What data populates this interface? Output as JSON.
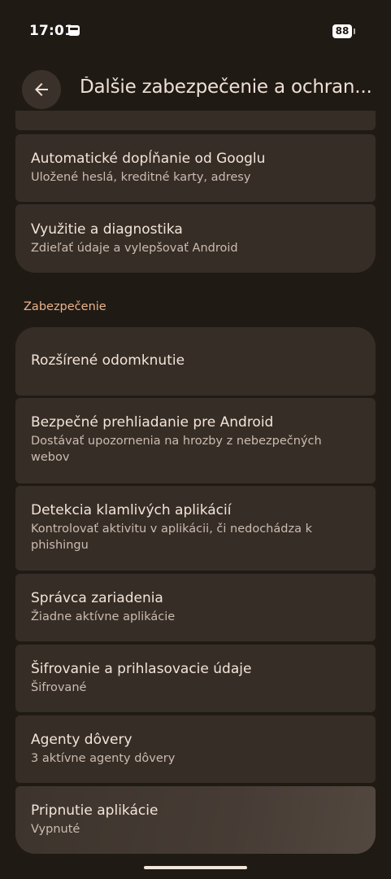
{
  "status_bar": {
    "time": "17:01",
    "battery": "88",
    "notification_icon": "wallet-icon"
  },
  "header": {
    "title": "Ďalšie zabezpečenie a ochran...",
    "back_icon": "arrow-back-icon"
  },
  "items_top": [
    {
      "title": "Automatické dopĺňanie od Googlu",
      "subtitle": "Uložené heslá, kreditné karty, adresy"
    },
    {
      "title": "Využitie a diagnostika",
      "subtitle": "Zdieľať údaje a vylepšovať Android"
    }
  ],
  "section": {
    "title": "Zabezpečenie"
  },
  "items_security": [
    {
      "title": "Rozšírené odomknutie",
      "subtitle": ""
    },
    {
      "title": "Bezpečné prehliadanie pre Android",
      "subtitle": "Dostávať upozornenia na hrozby z nebezpečných webov"
    },
    {
      "title": "Detekcia klamlivých aplikácií",
      "subtitle": "Kontrolovať aktivitu v aplikácii, či nedochádza k phishingu"
    },
    {
      "title": "Správca zariadenia",
      "subtitle": "Žiadne aktívne aplikácie"
    },
    {
      "title": "Šifrovanie a prihlasovacie údaje",
      "subtitle": "Šifrované"
    },
    {
      "title": "Agenty dôvery",
      "subtitle": "3 aktívne agenty dôvery"
    },
    {
      "title": "Pripnutie aplikácie",
      "subtitle": "Vypnuté"
    }
  ],
  "colors": {
    "background": "#201a15",
    "card": "#362d27",
    "accent": "#e9b48c"
  }
}
